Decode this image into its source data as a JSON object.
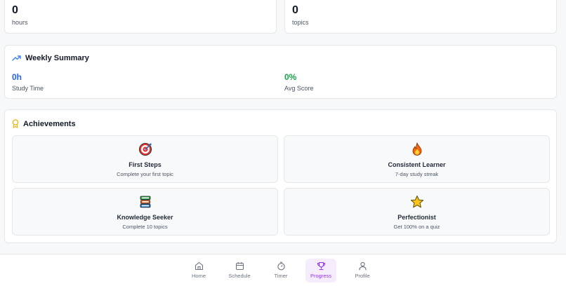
{
  "stats": [
    {
      "value": "0",
      "unit": "hours"
    },
    {
      "value": "0",
      "unit": "topics"
    }
  ],
  "weekly_summary": {
    "title": "Weekly Summary",
    "study_time": {
      "value": "0h",
      "label": "Study Time",
      "color": "#2563eb"
    },
    "avg_score": {
      "value": "0%",
      "label": "Avg Score",
      "color": "#16a34a"
    }
  },
  "achievements": {
    "title": "Achievements",
    "items": [
      {
        "icon": "target-icon",
        "title": "First Steps",
        "description": "Complete your first topic"
      },
      {
        "icon": "fire-icon",
        "title": "Consistent Learner",
        "description": "7-day study streak"
      },
      {
        "icon": "books-icon",
        "title": "Knowledge Seeker",
        "description": "Complete 10 topics"
      },
      {
        "icon": "star-icon",
        "title": "Perfectionist",
        "description": "Get 100% on a quiz"
      }
    ]
  },
  "nav": {
    "items": [
      {
        "label": "Home",
        "icon": "home-icon"
      },
      {
        "label": "Schedule",
        "icon": "calendar-icon"
      },
      {
        "label": "Timer",
        "icon": "timer-icon"
      },
      {
        "label": "Progress",
        "icon": "trophy-icon",
        "active": true
      },
      {
        "label": "Profile",
        "icon": "user-icon"
      }
    ],
    "active_color": "#9333ea"
  }
}
